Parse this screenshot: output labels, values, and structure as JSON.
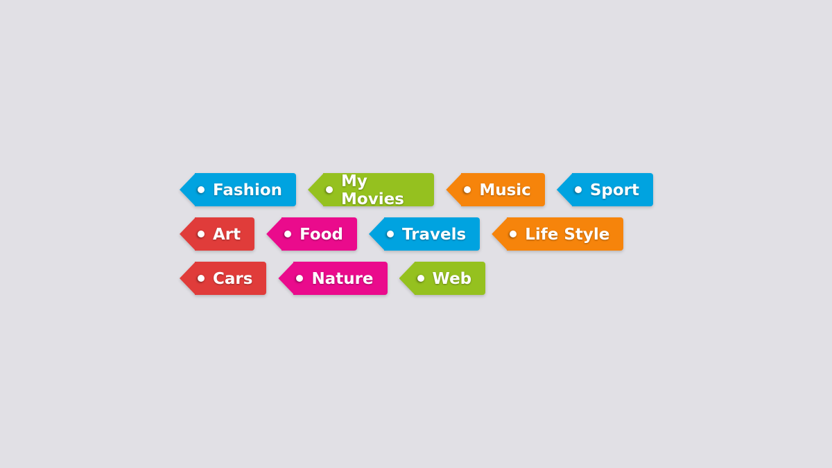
{
  "colors": {
    "blue": "#00a3e0",
    "green": "#95c11f",
    "orange": "#f6840b",
    "red": "#e03c3a",
    "pink": "#ea0b8c"
  },
  "rows": [
    [
      {
        "label": "Fashion",
        "color": "#00a3e0"
      },
      {
        "label": "My Movies",
        "color": "#95c11f"
      },
      {
        "label": "Music",
        "color": "#f6840b"
      },
      {
        "label": "Sport",
        "color": "#00a3e0"
      }
    ],
    [
      {
        "label": "Art",
        "color": "#e03c3a"
      },
      {
        "label": "Food",
        "color": "#ea0b8c"
      },
      {
        "label": "Travels",
        "color": "#00a3e0"
      },
      {
        "label": "Life Style",
        "color": "#f6840b"
      }
    ],
    [
      {
        "label": "Cars",
        "color": "#e03c3a"
      },
      {
        "label": "Nature",
        "color": "#ea0b8c"
      },
      {
        "label": "Web",
        "color": "#95c11f"
      }
    ]
  ]
}
